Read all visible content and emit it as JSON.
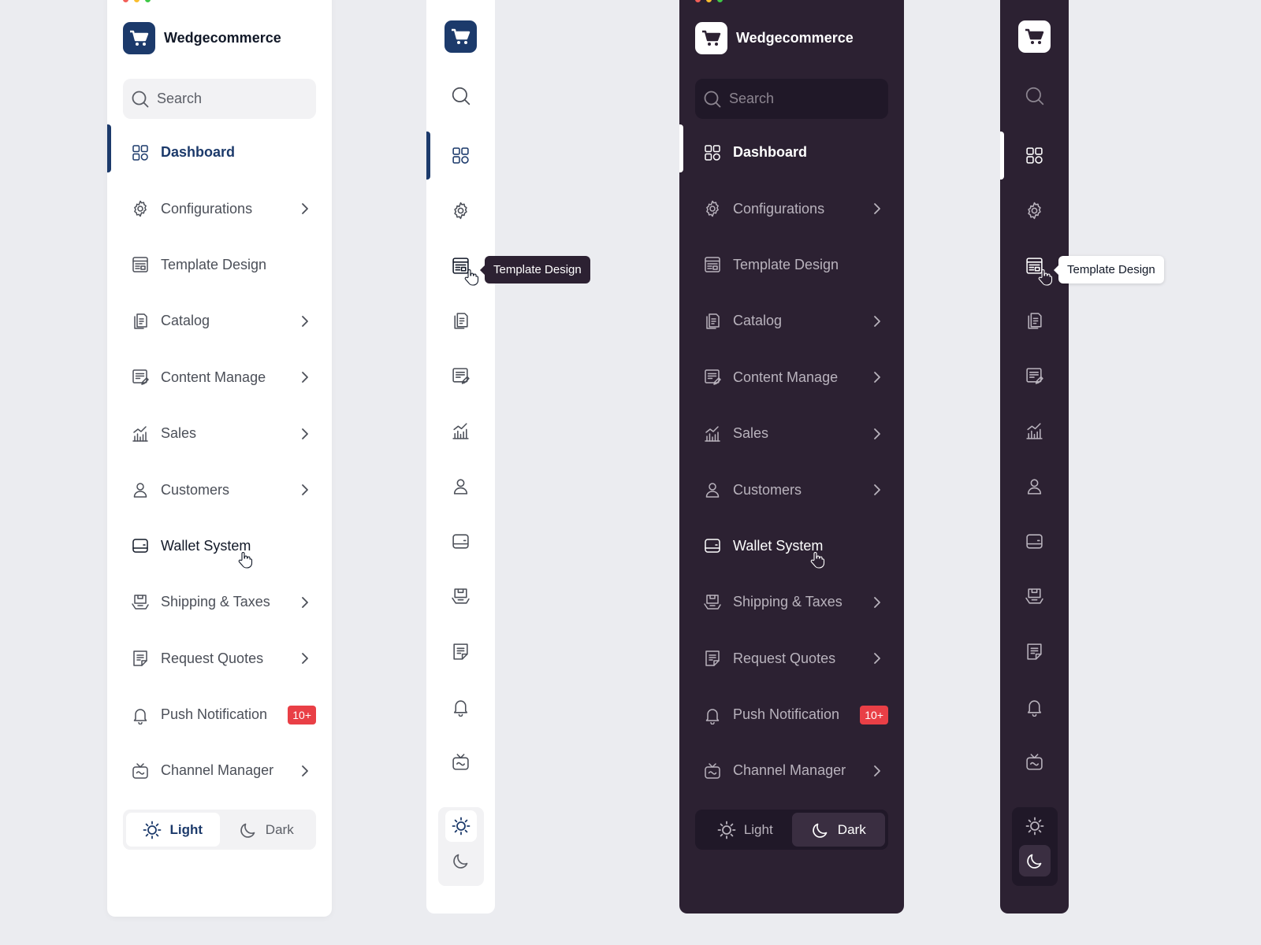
{
  "brand": {
    "name": "Wedgecommerce"
  },
  "search": {
    "placeholder": "Search"
  },
  "nav": [
    {
      "label": "Dashboard",
      "icon": "dashboard-icon",
      "has_submenu": false
    },
    {
      "label": "Configurations",
      "icon": "gear-icon",
      "has_submenu": true
    },
    {
      "label": "Template Design",
      "icon": "template-icon",
      "has_submenu": false
    },
    {
      "label": "Catalog",
      "icon": "catalog-icon",
      "has_submenu": true
    },
    {
      "label": "Content Manage",
      "icon": "content-icon",
      "has_submenu": true
    },
    {
      "label": "Sales",
      "icon": "sales-chart-icon",
      "has_submenu": true
    },
    {
      "label": "Customers",
      "icon": "user-icon",
      "has_submenu": true
    },
    {
      "label": "Wallet System",
      "icon": "wallet-icon",
      "has_submenu": false
    },
    {
      "label": "Shipping & Taxes",
      "icon": "shipping-box-icon",
      "has_submenu": true
    },
    {
      "label": "Request Quotes",
      "icon": "quote-icon",
      "has_submenu": true
    },
    {
      "label": "Push Notification",
      "icon": "bell-icon",
      "has_submenu": false,
      "badge": "10+"
    },
    {
      "label": "Channel Manager",
      "icon": "tv-icon",
      "has_submenu": true
    }
  ],
  "active_item": "Dashboard",
  "hovered_item": "Wallet System",
  "tooltip": {
    "text": "Template Design"
  },
  "theme": {
    "light_label": "Light",
    "dark_label": "Dark"
  },
  "colors": {
    "page_bg": "#ebecf0",
    "brand_navy": "#1c3a6b",
    "dark_panel": "#2c2132",
    "badge_red": "#e93f46"
  }
}
